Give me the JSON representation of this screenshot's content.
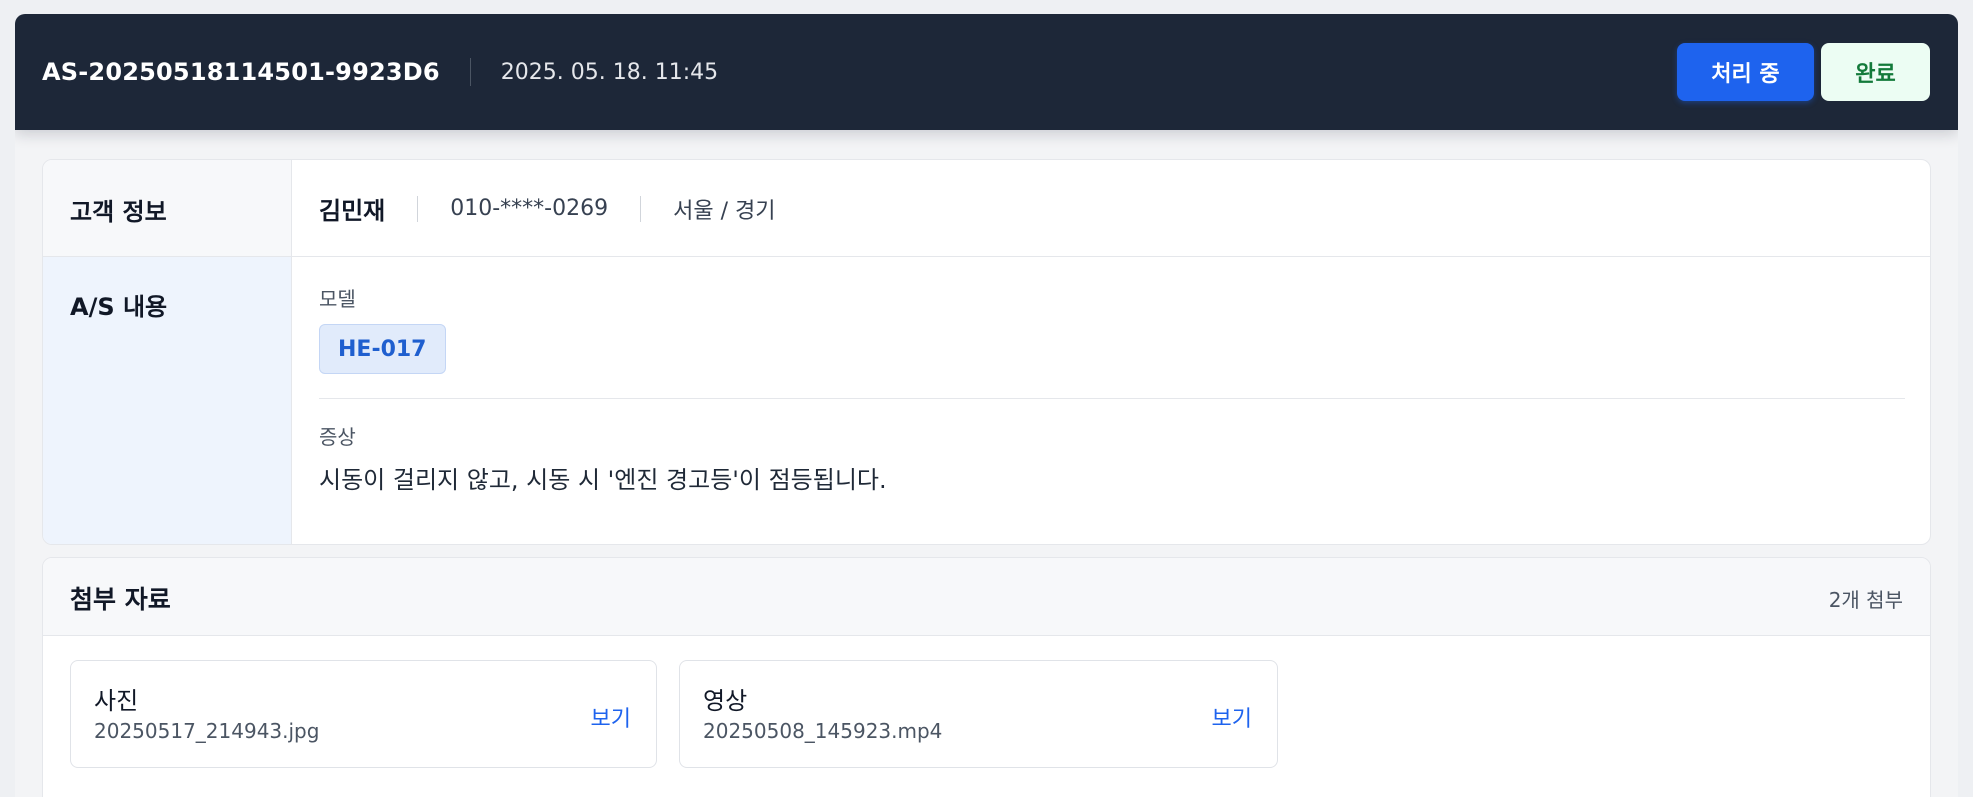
{
  "header": {
    "ticket_id": "AS-20250518114501-9923D6",
    "datetime": "2025. 05. 18. 11:45",
    "processing_label": "처리 중",
    "done_label": "완료"
  },
  "customer": {
    "section_label": "고객 정보",
    "name": "김민재",
    "phone": "010-****-0269",
    "region": "서울 / 경기"
  },
  "as": {
    "section_label": "A/S 내용",
    "model_label": "모델",
    "model_value": "HE-017",
    "symptom_label": "증상",
    "symptom_text": "시동이 걸리지 않고, 시동 시 '엔진 경고등'이 점등됩니다."
  },
  "attachments": {
    "title": "첨부 자료",
    "count_label": "2개 첨부",
    "files": [
      {
        "type": "사진",
        "name": "20250517_214943.jpg",
        "action": "보기"
      },
      {
        "type": "영상",
        "name": "20250508_145923.mp4",
        "action": "보기"
      }
    ]
  }
}
